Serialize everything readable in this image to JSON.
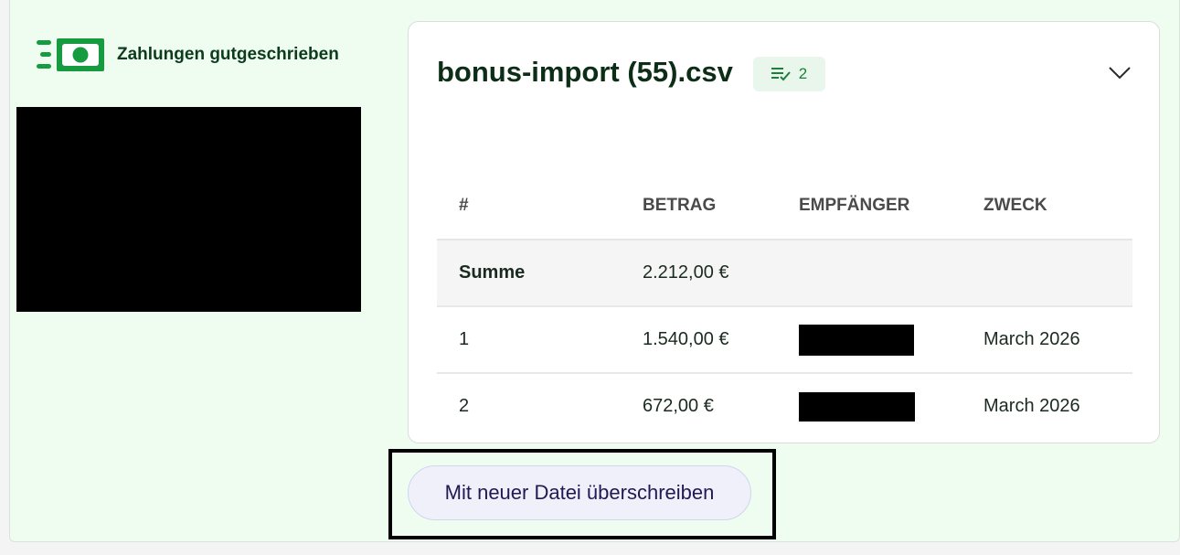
{
  "status": {
    "label": "Zahlungen gutgeschrieben",
    "icon": "money-bill-icon",
    "color": "#169b40"
  },
  "file": {
    "name": "bonus-import (55).csv",
    "row_count": "2",
    "badge_icon": "list-check-icon",
    "toggle_icon": "chevron-down-icon"
  },
  "table": {
    "headers": [
      "#",
      "BETRAG",
      "EMPFÄNGER",
      "ZWECK"
    ],
    "sum": {
      "label": "Summe",
      "amount": "2.212,00 €"
    },
    "rows": [
      {
        "index": "1",
        "amount": "1.540,00 €",
        "purpose": "March 2026"
      },
      {
        "index": "2",
        "amount": "672,00 €",
        "purpose": "March 2026"
      }
    ]
  },
  "actions": {
    "overwrite_label": "Mit neuer Datei überschreiben"
  }
}
